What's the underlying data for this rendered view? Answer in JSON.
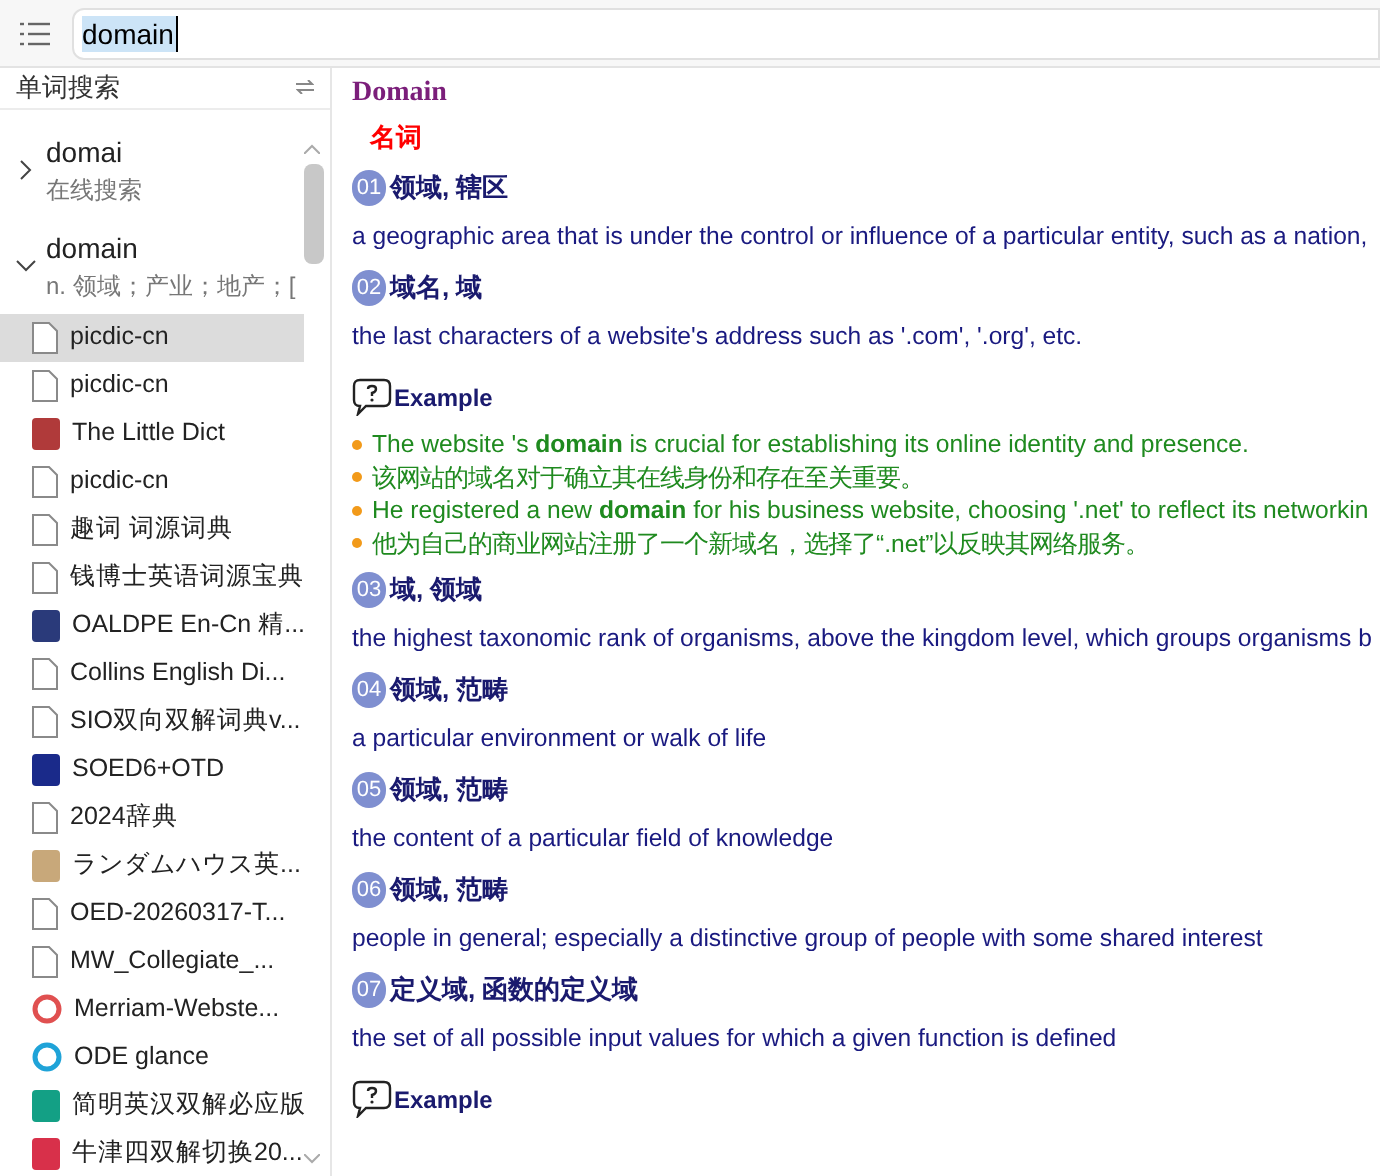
{
  "search": {
    "value": "domain"
  },
  "sidebar": {
    "title": "单词搜索",
    "results": [
      {
        "word": "domai",
        "subtitle": "在线搜索",
        "expanded": false
      },
      {
        "word": "domain",
        "subtitle": "n. 领域；产业；地产；[",
        "expanded": true,
        "children": [
          {
            "label": "picdic-cn",
            "kind": "file",
            "selected": true
          },
          {
            "label": "picdic-cn",
            "kind": "file",
            "selected": false
          },
          {
            "label": "The Little Dict",
            "kind": "logo",
            "color": "#b03a3a",
            "selected": false
          },
          {
            "label": "picdic-cn",
            "kind": "file",
            "selected": false
          },
          {
            "label": "趣词 词源词典",
            "kind": "file",
            "selected": false
          },
          {
            "label": "钱博士英语词源宝典",
            "kind": "file",
            "selected": false
          },
          {
            "label": "OALDPE En-Cn 精...",
            "kind": "logo",
            "color": "#2a3a7a",
            "selected": false
          },
          {
            "label": "Collins English Di...",
            "kind": "file",
            "selected": false
          },
          {
            "label": "SIO双向双解词典v...",
            "kind": "file",
            "selected": false
          },
          {
            "label": "SOED6+OTD",
            "kind": "logo",
            "color": "#1a2a8a",
            "selected": false
          },
          {
            "label": "2024辞典",
            "kind": "file",
            "selected": false
          },
          {
            "label": "ランダムハウス英...",
            "kind": "logo",
            "color": "#c8a87a",
            "selected": false
          },
          {
            "label": "OED-20260317-T...",
            "kind": "file",
            "selected": false
          },
          {
            "label": "MW_Collegiate_...",
            "kind": "file",
            "selected": false
          },
          {
            "label": "Merriam-Webste...",
            "kind": "ring",
            "color": "#e05050",
            "selected": false
          },
          {
            "label": "ODE glance",
            "kind": "ring",
            "color": "#1fa3d8",
            "selected": false
          },
          {
            "label": "简明英汉双解必应版",
            "kind": "logo",
            "color": "#13a085",
            "selected": false
          },
          {
            "label": "牛津四双解切换20...",
            "kind": "logo",
            "color": "#d8304a",
            "selected": false
          }
        ]
      }
    ]
  },
  "entry": {
    "headword": "Domain",
    "pos": "名词",
    "blocks": [
      {
        "kind": "sense",
        "number": "01",
        "zh": "领域, 辖区",
        "en": "a geographic area that is under the control or influence of a particular entity, such as a nation,"
      },
      {
        "kind": "sense",
        "number": "02",
        "zh": "域名, 域",
        "en": "the last characters of a website's address such as '.com', '.org', etc."
      },
      {
        "kind": "example",
        "label": "Example",
        "lines": [
          "The website 's **domain** is crucial for establishing its online identity and presence.",
          "该网站的域名对于确立其在线身份和存在至关重要。",
          "He registered a new **domain** for his business website, choosing '.net' to reflect its networkin",
          "他为自己的商业网站注册了一个新域名，选择了“.net”以反映其网络服务。"
        ]
      },
      {
        "kind": "sense",
        "number": "03",
        "zh": "域, 领域",
        "en": "the highest taxonomic rank of organisms, above the kingdom level, which groups organisms b"
      },
      {
        "kind": "sense",
        "number": "04",
        "zh": "领域, 范畴",
        "en": "a particular environment or walk of life"
      },
      {
        "kind": "sense",
        "number": "05",
        "zh": "领域, 范畴",
        "en": "the content of a particular field of knowledge"
      },
      {
        "kind": "sense",
        "number": "06",
        "zh": "领域, 范畴",
        "en": "people in general; especially a distinctive group of people with some shared interest"
      },
      {
        "kind": "sense",
        "number": "07",
        "zh": "定义域, 函数的定义域",
        "en": "the set of all possible input values for which a given function is defined"
      },
      {
        "kind": "example",
        "label": "Example"
      }
    ]
  }
}
